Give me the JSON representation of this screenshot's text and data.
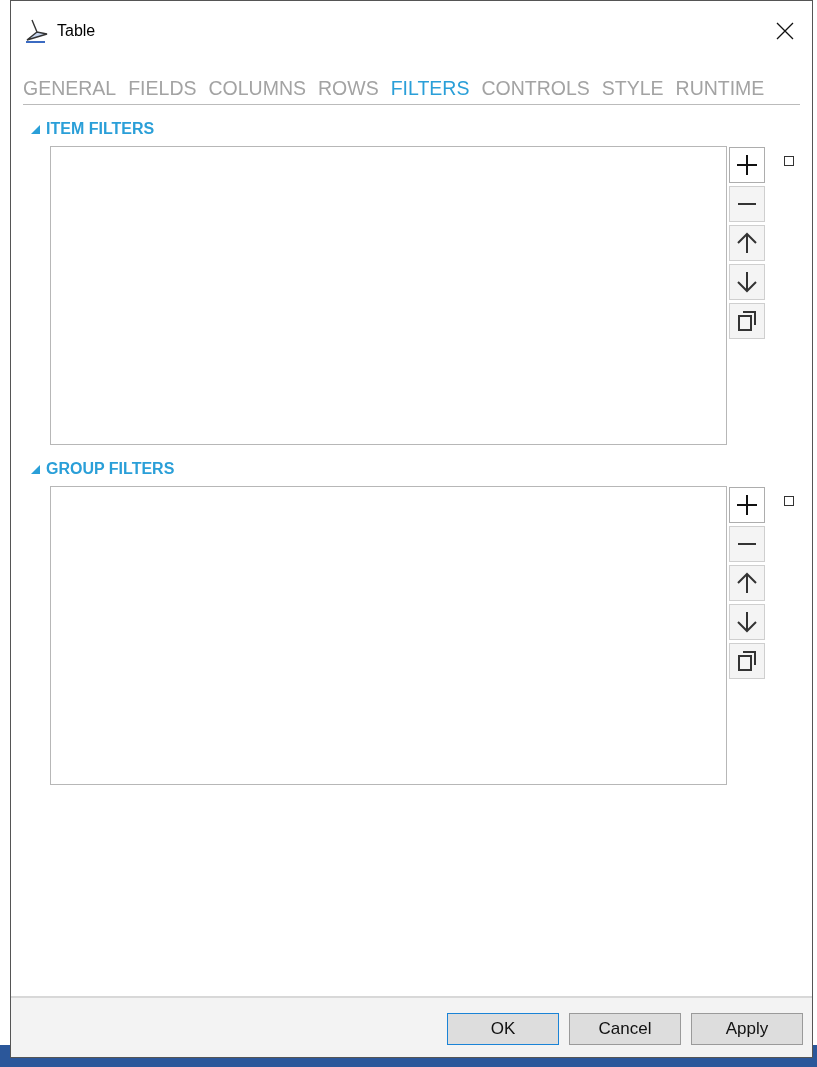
{
  "window": {
    "title": "Table"
  },
  "tabs": [
    {
      "label": "GENERAL",
      "selected": false
    },
    {
      "label": "FIELDS",
      "selected": false
    },
    {
      "label": "COLUMNS",
      "selected": false
    },
    {
      "label": "ROWS",
      "selected": false
    },
    {
      "label": "FILTERS",
      "selected": true
    },
    {
      "label": "CONTROLS",
      "selected": false
    },
    {
      "label": "STYLE",
      "selected": false
    },
    {
      "label": "RUNTIME",
      "selected": false
    }
  ],
  "sections": [
    {
      "title": "ITEM FILTERS",
      "expanded": true,
      "checked": false,
      "tools": [
        {
          "kind": "add",
          "focused": true
        },
        {
          "kind": "remove",
          "focused": false
        },
        {
          "kind": "up",
          "focused": false
        },
        {
          "kind": "down",
          "focused": false
        },
        {
          "kind": "copy",
          "focused": false
        }
      ]
    },
    {
      "title": "GROUP FILTERS",
      "expanded": true,
      "checked": false,
      "tools": [
        {
          "kind": "add",
          "focused": true
        },
        {
          "kind": "remove",
          "focused": false
        },
        {
          "kind": "up",
          "focused": false
        },
        {
          "kind": "down",
          "focused": false
        },
        {
          "kind": "copy",
          "focused": false
        }
      ]
    }
  ],
  "buttons": [
    {
      "label": "OK",
      "default": true
    },
    {
      "label": "Cancel",
      "default": false
    },
    {
      "label": "Apply",
      "default": false
    }
  ]
}
